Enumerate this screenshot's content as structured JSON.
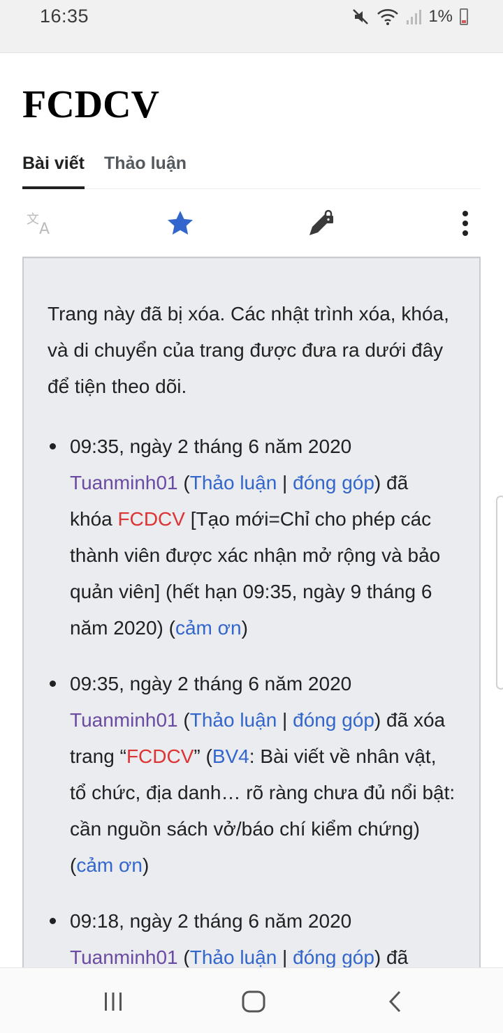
{
  "status": {
    "time": "16:35",
    "battery": "1%"
  },
  "page": {
    "title": "FCDCV",
    "tabs": [
      {
        "label": "Bài viết",
        "active": true
      },
      {
        "label": "Thảo luận",
        "active": false
      }
    ]
  },
  "toolbar": {
    "icons": [
      "translate-icon",
      "star-icon",
      "edit-lock-icon",
      "more-icon"
    ],
    "accent": "#3366cc"
  },
  "notice": {
    "intro": "Trang này đã bị xóa. Các nhật trình xóa, khóa, và di chuyển của trang được đưa ra dưới đây để tiện theo dõi.",
    "logs": [
      {
        "timestamp": "09:35, ngày 2 tháng 6 năm 2020",
        "user": "Tuanminh01",
        "open": " (",
        "talk": "Thảo luận",
        "sep": " | ",
        "contribs": "đóng góp",
        "action": ") đã khóa ",
        "target": "FCDCV",
        "detail": " [Tạo mới=Chỉ cho phép các thành viên được xác nhận mở rộng và bảo quản viên] (hết hạn 09:35, ngày 9 tháng 6 năm 2020) (",
        "thanks": "cảm ơn",
        "close": ")"
      },
      {
        "timestamp": "09:35, ngày 2 tháng 6 năm 2020",
        "user": "Tuanminh01",
        "open": " (",
        "talk": "Thảo luận",
        "sep": " | ",
        "contribs": "đóng góp",
        "action": ") đã xóa trang “",
        "target": "FCDCV",
        "mid": "” (",
        "reason_link": "BV4",
        "detail": ": Bài viết về nhân vật, tổ chức, địa danh… rõ ràng chưa đủ nổi bật: cần nguồn sách vở/báo chí kiểm chứng) (",
        "thanks": "cảm ơn",
        "close": ")"
      },
      {
        "timestamp": "09:18, ngày 2 tháng 6 năm 2020",
        "user": "Tuanminh01",
        "open": " (",
        "talk": "Thảo luận",
        "sep": " | ",
        "contribs": "đóng góp",
        "action": ") đã"
      }
    ]
  },
  "navbar": {
    "icons": [
      "recent-apps-icon",
      "home-icon",
      "back-icon"
    ]
  },
  "colors": {
    "user": "#6b4ba1",
    "link": "#3366cc",
    "redlink": "#dd3333",
    "notice_bg": "#eaecf0"
  }
}
